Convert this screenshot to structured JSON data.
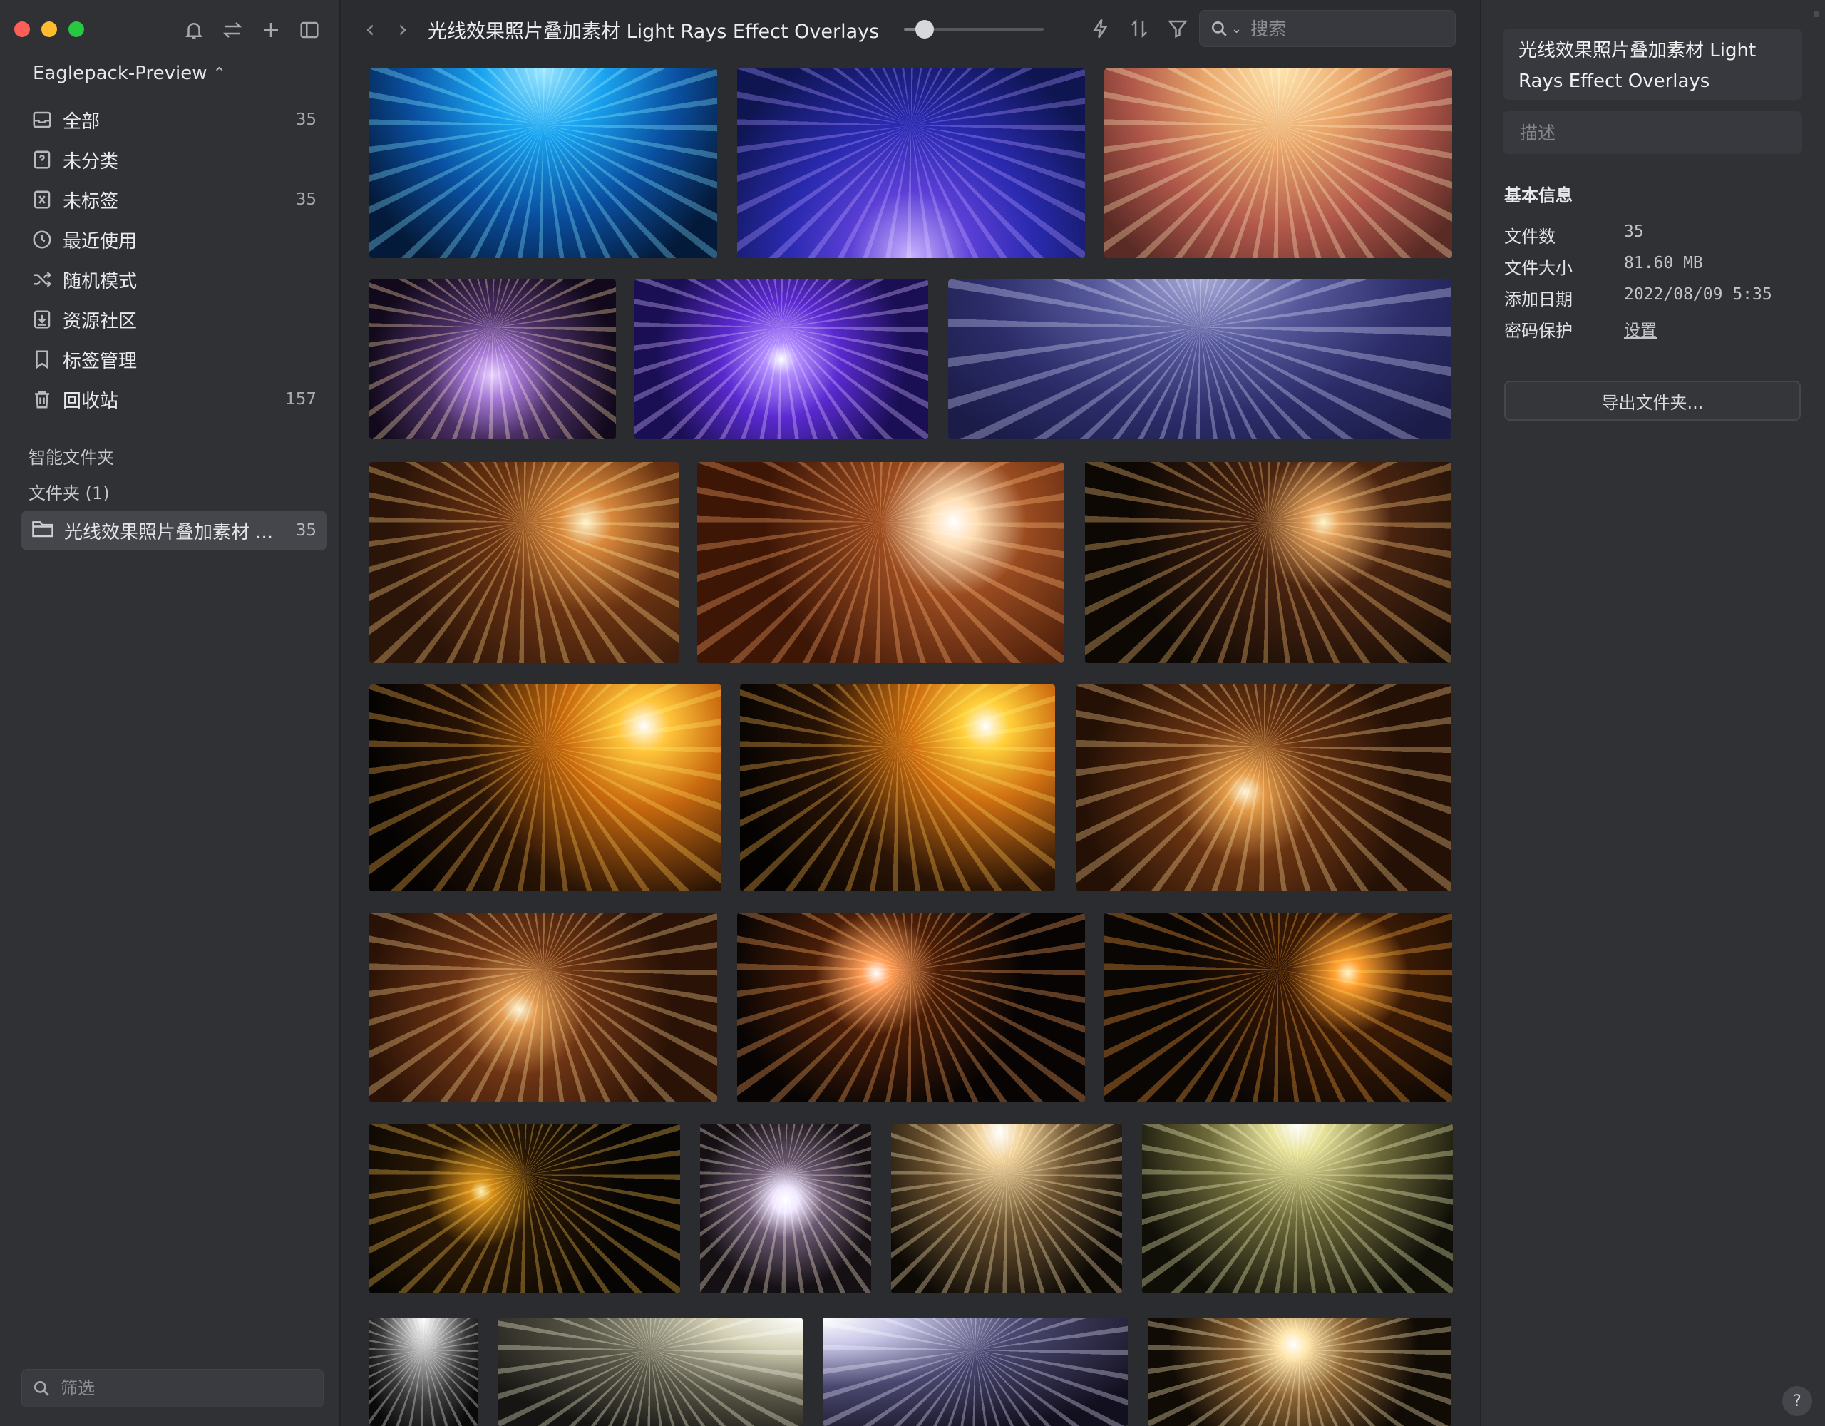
{
  "sidebar": {
    "library_name": "Eaglepack-Preview",
    "items": [
      {
        "icon": "inbox-icon",
        "label": "全部",
        "count": "35"
      },
      {
        "icon": "question-box-icon",
        "label": "未分类",
        "count": ""
      },
      {
        "icon": "untagged-icon",
        "label": "未标签",
        "count": "35"
      },
      {
        "icon": "clock-icon",
        "label": "最近使用",
        "count": ""
      },
      {
        "icon": "shuffle-icon",
        "label": "随机模式",
        "count": ""
      },
      {
        "icon": "download-box-icon",
        "label": "资源社区",
        "count": ""
      },
      {
        "icon": "bookmark-icon",
        "label": "标签管理",
        "count": ""
      },
      {
        "icon": "trash-icon",
        "label": "回收站",
        "count": "157"
      }
    ],
    "smart_folders_title": "智能文件夹",
    "folders_title": "文件夹 (1)",
    "active_folder": {
      "label": "光线效果照片叠加素材 ...",
      "count": "35"
    },
    "filter_placeholder": "筛选"
  },
  "toolbar": {
    "title": "光线效果照片叠加素材 Light Rays Effect Overlays",
    "zoom_level": 0.15,
    "search_placeholder": "搜索"
  },
  "thumbnails": [
    {
      "row": 1,
      "bg": "radial-gradient(ellipse at 50% 0%, #9fe8ff 0%, #1aa3f0 25%, #0a4fa0 55%, #041a3a 85%)",
      "rays": "#7ad8ff"
    },
    {
      "row": 1,
      "bg": "radial-gradient(ellipse at 50% 100%, #c9b3ff 0%, #5b3fd6 25%, #2a2ab0 50%, #0e1550 85%)",
      "rays": "#9f86ff"
    },
    {
      "row": 1,
      "bg": "radial-gradient(ellipse at 50% 0%, #ffe6b0 0%, #e9a66b 30%, #b0574a 60%, #5a2a25 90%)",
      "rays": "#ffd8a0"
    },
    {
      "row": 2,
      "bg": "radial-gradient(circle at 50% 60%, #e8d0ff 0%, #a77ad8 15%, #4a2f64 40%, #120a1c 80%)",
      "rays": "#ffd99a"
    },
    {
      "row": 2,
      "bg": "radial-gradient(circle at 50% 50%, #ffffff 0%, #b18cff 10%, #5a2ad0 35%, #1a0f55 75%)",
      "rays": "#d4b6ff"
    },
    {
      "row": 2,
      "bg": "radial-gradient(ellipse at 50% 0%, #a6a8d6 0%, #55589a 30%, #2c2d6a 60%, #1b1c48 90%)",
      "rays": "#c7c9f0"
    },
    {
      "row": 3,
      "bg": "radial-gradient(circle at 70% 30%, #fff2c8 0%, #d9893c 10%, #6a3312 35%, #2b1408 75%)",
      "rays": "#ffca7a"
    },
    {
      "row": 3,
      "bg": "radial-gradient(circle at 70% 30%, #ffffff 0%, #ffdcb2 8%, #9a4b20 25%, #3d1606 65%)",
      "rays": "#ff9d62"
    },
    {
      "row": 3,
      "bg": "radial-gradient(circle at 65% 30%, #fff2c8 0%, #e4a05b 6%, #4a2410 25%, #0d0804 70%)",
      "rays": "#ffbf72"
    },
    {
      "row": 4,
      "bg": "radial-gradient(circle at 78% 20%, #ffffff 0%, #ffc53a 8%, #c96a0f 25%, #2a1405 55%, #050302 85%)",
      "rays": "#ffb347"
    },
    {
      "row": 4,
      "bg": "radial-gradient(circle at 78% 20%, #ffffff 0%, #ffd03a 8%, #d07012 25%, #2a1405 55%, #050302 85%)",
      "rays": "#ffb347"
    },
    {
      "row": 4,
      "bg": "radial-gradient(circle at 45% 52%, #fff5d8 0%, #e39a48 8%, #6a3412 30%, #241005 70%)",
      "rays": "#ffcf8a"
    },
    {
      "row": 5,
      "bg": "radial-gradient(circle at 43% 51%, #fff5d8 0%, #e19a50 8%, #6e3514 30%, #2a1206 70%)",
      "rays": "#ffcf8a"
    },
    {
      "row": 5,
      "bg": "radial-gradient(circle at 40% 32%, #ffffff 0%, #ff9b55 6%, #4a1e08 25%, #070403 60%)",
      "rays": "#ffa35c"
    },
    {
      "row": 5,
      "bg": "radial-gradient(circle at 70% 32%, #fff2c8 0%, #ff9e2e 5%, #3a1a05 22%, #0a0604 60%)",
      "rays": "#ff9f33"
    },
    {
      "row": 6,
      "bg": "radial-gradient(circle at 36% 40%, #fff0b0 0%, #d88f1a 5%, #2a1804 25%, #060503 65%)",
      "rays": "#ffc04a"
    },
    {
      "row": 6,
      "bg": "radial-gradient(circle at 50% 45%, #ffffff 0%, #f0e6ff 10%, #6a5870 30%, #141014 70%)",
      "rays": "#ffe8d0"
    },
    {
      "row": 6,
      "bg": "radial-gradient(ellipse at 47% 5%, #ffffff 0%, #f2d29a 12%, #6e5430 40%, #0d0a06 80%)",
      "rays": "#ffe2aa"
    },
    {
      "row": 6,
      "bg": "radial-gradient(ellipse at 50% 0%, #ffffff 0%, #e8e39a 12%, #6e6b3a 40%, #0f0f08 80%)",
      "rays": "#f3efb0"
    },
    {
      "row": 7,
      "bg": "radial-gradient(ellipse at 50% 0%, #ffffff 0%, #bfbfbf 20%, #3a3a3a 55%, #0a0a0a 85%)",
      "rays": "#e8e8e8"
    },
    {
      "row": 7,
      "bg": "radial-gradient(ellipse at 100% 0%, #ffffff 0%, #d6d3b8 20%, #5a5848 50%, #161513 85%)",
      "rays": "#efeccc"
    },
    {
      "row": 7,
      "bg": "radial-gradient(ellipse at 0% 0%, #ffffff 0%, #c9c7e8 18%, #4a4870 45%, #120f1e 85%)",
      "rays": "#dcdaf6"
    },
    {
      "row": 7,
      "bg": "radial-gradient(circle at 48% 25%, #ffffff 0%, #ffe4a8 8%, #8a6232 30%, #110b05 70%)",
      "rays": "#ffeab8"
    }
  ],
  "inspector": {
    "title": "光线效果照片叠加素材 Light Rays Effect Overlays",
    "description_placeholder": "描述",
    "section_title": "基本信息",
    "rows": [
      {
        "key": "文件数",
        "value": "35"
      },
      {
        "key": "文件大小",
        "value": "81.60 MB"
      },
      {
        "key": "添加日期",
        "value": "2022/08/09 5:35"
      },
      {
        "key": "密码保护",
        "value": "设置"
      }
    ],
    "export_label": "导出文件夹...",
    "help_label": "?"
  }
}
